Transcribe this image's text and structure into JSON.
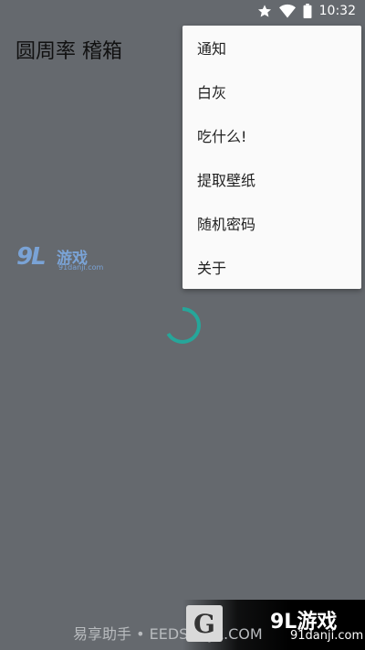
{
  "status_bar": {
    "time": "10:32",
    "icons": [
      "star-icon",
      "wifi-icon",
      "battery-icon"
    ]
  },
  "toolbar": {
    "title": "圆周率 稽箱"
  },
  "overflow_menu": {
    "items": [
      {
        "label": "通知"
      },
      {
        "label": "白灰"
      },
      {
        "label": "吃什么!"
      },
      {
        "label": "提取壁纸"
      },
      {
        "label": "随机密码"
      },
      {
        "label": "关于"
      }
    ]
  },
  "watermarks": {
    "logo_91_mark": "9L",
    "logo_91_text": "游戏",
    "logo_91_url": "91danji.com",
    "bottom_text": "易享助手 • EEDSHZJZ.COM",
    "bottom_g": "G",
    "bottom_91_text": "9L游戏",
    "bottom_91_url": "91danji.com"
  },
  "colors": {
    "background": "#65696e",
    "menu_background": "#fafafa",
    "spinner": "#26a69a"
  },
  "loading": {
    "icon": "loading-spinner-icon"
  }
}
